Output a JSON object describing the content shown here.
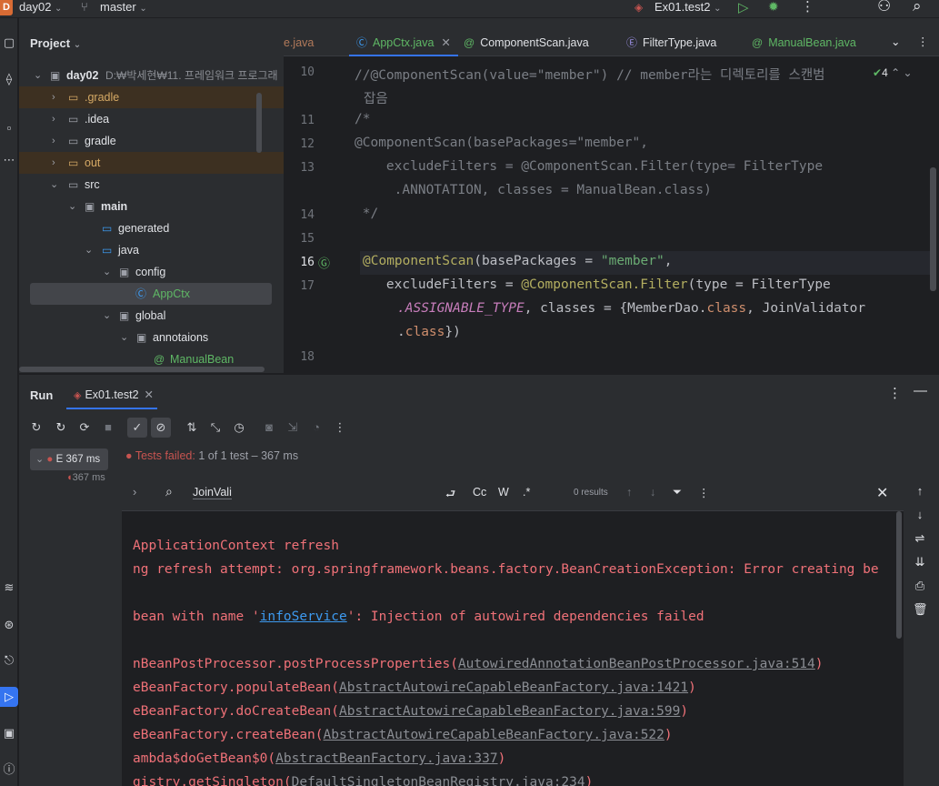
{
  "titlebar": {
    "project_badge": "D",
    "project_name": "day02",
    "branch": "master",
    "run_config": "Ex01.test2"
  },
  "toolstrip": {
    "icons": [
      "folder-icon",
      "commit-icon",
      "structure-icon",
      "more-icon",
      "layers-icon",
      "services-icon",
      "terminal-icon",
      "run-icon",
      "problems-icon",
      "git-icon"
    ]
  },
  "project": {
    "title": "Project",
    "root_name": "day02",
    "root_path": "D:₩박세현₩11. 프레임워크 프로그래",
    "items": [
      {
        "label": ".gradle"
      },
      {
        "label": ".idea"
      },
      {
        "label": "gradle"
      },
      {
        "label": "out"
      },
      {
        "label": "src"
      },
      {
        "label": "main"
      },
      {
        "label": "generated"
      },
      {
        "label": "java"
      },
      {
        "label": "config"
      },
      {
        "label": "AppCtx"
      },
      {
        "label": "global"
      },
      {
        "label": "annotaions"
      },
      {
        "label": "ManualBean"
      }
    ]
  },
  "editor": {
    "tabs": [
      {
        "label": "e.java"
      },
      {
        "label": "AppCtx.java"
      },
      {
        "label": "ComponentScan.java"
      },
      {
        "label": "FilterType.java"
      },
      {
        "label": "ManualBean.java"
      }
    ],
    "inspection_count": "4",
    "line_numbers": [
      "10",
      "11",
      "12",
      "13",
      "14",
      "15",
      "16",
      "17",
      "18"
    ],
    "code": {
      "l10a": "//@ComponentScan(value=\"member\") // member라는 디렉토리를 스캔범",
      "l10b": "잡음",
      "l11": "/*",
      "l12": "@ComponentScan(basePackages=\"member\",",
      "l13a": "    excludeFilters = @ComponentScan.Filter(type= FilterType",
      "l13b": "     .ANNOTATION, classes = ManualBean.class)",
      "l14": " */",
      "l16_ann": "@ComponentScan",
      "l16_mid": "(basePackages = ",
      "l16_str": "\"member\"",
      "l16_end": ",",
      "l17_pre": "    excludeFilters = ",
      "l17_ann": "@ComponentScan.Filter",
      "l17_mid": "(type = FilterType",
      "l17b_const": ".ASSIGNABLE_TYPE",
      "l17b_mid": ", classes = {MemberDao.",
      "l17b_kw": "class",
      "l17b_end": ", JoinValidator",
      "l17c_dot": ".",
      "l17c_kw": "class",
      "l17c_end": "})"
    }
  },
  "run": {
    "title": "Run",
    "tab": "Ex01.test2",
    "root_test": "E 367 ms",
    "child_test": "367 ms",
    "status_prefix": "Tests failed:",
    "status_rest": "1 of 1 test – 367 ms",
    "find": {
      "query": "JoinVali",
      "opt_regex_replace": "⮐",
      "opt_case": "Cc",
      "opt_word": "W",
      "opt_regex": ".*",
      "results": "0 results"
    },
    "console": {
      "l1": "ApplicationContext refresh",
      "l2": "ng refresh attempt: org.springframework.beans.factory.BeanCreationException: Error creating be",
      "l3_pre": "bean with name '",
      "l3_link": "infoService",
      "l3_post": "': Injection of autowired dependencies failed",
      "l4_pre": "nBeanPostProcessor.postProcessProperties(",
      "l4_link": "AutowiredAnnotationBeanPostProcessor.java:514",
      "l4_post": ")",
      "l5_pre": "eBeanFactory.populateBean(",
      "l5_link": "AbstractAutowireCapableBeanFactory.java:1421",
      "l5_post": ")",
      "l6_pre": "eBeanFactory.doCreateBean(",
      "l6_link": "AbstractAutowireCapableBeanFactory.java:599",
      "l6_post": ")",
      "l7_pre": "eBeanFactory.createBean(",
      "l7_link": "AbstractAutowireCapableBeanFactory.java:522",
      "l7_post": ")",
      "l8_pre": "ambda$doGetBean$0(",
      "l8_link": "AbstractBeanFactory.java:337",
      "l8_post": ")",
      "l9_pre": "gistry.getSingleton(",
      "l9_link": "DefaultSingletonBeanRegistry.java:234",
      "l9_post": ")"
    }
  },
  "colors": {
    "accent": "#3574f0",
    "error": "#c75450",
    "success": "#5fb865"
  }
}
